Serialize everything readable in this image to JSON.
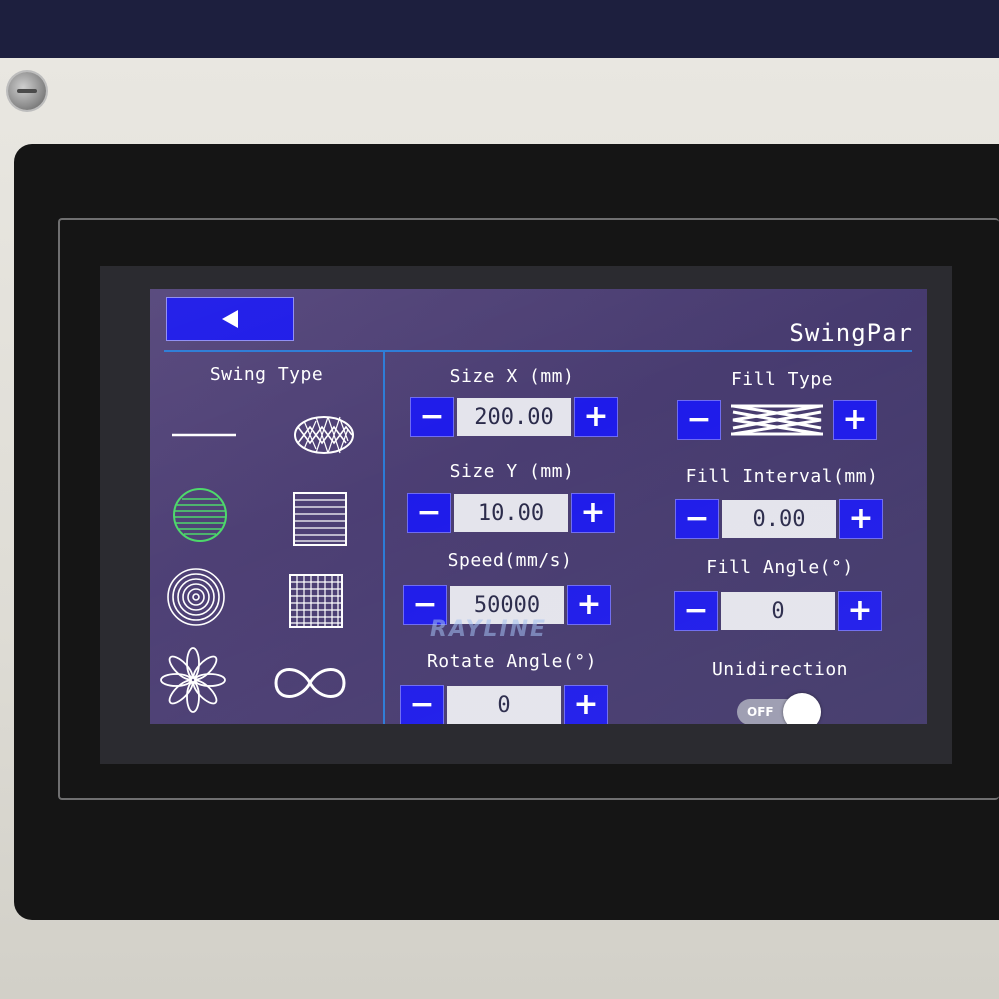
{
  "header": {
    "title": "SwingPar"
  },
  "swing_type": {
    "title": "Swing Type",
    "icons": [
      "line-pattern-icon",
      "crosshatch-oval-icon",
      "circle-lines-icon",
      "square-lines-icon",
      "concentric-circles-icon",
      "grid-square-icon",
      "flower-icon",
      "infinity-icon"
    ]
  },
  "fields": {
    "size_x": {
      "label": "Size X (mm)",
      "value": "200.00"
    },
    "size_y": {
      "label": "Size Y (mm)",
      "value": "10.00"
    },
    "speed": {
      "label": "Speed(mm/s)",
      "value": "50000"
    },
    "rotate_angle": {
      "label": "Rotate Angle(°)",
      "value": "0"
    },
    "fill_type": {
      "label": "Fill Type"
    },
    "fill_interval": {
      "label": "Fill Interval(mm)",
      "value": "0.00"
    },
    "fill_angle": {
      "label": "Fill Angle(°)",
      "value": "0"
    },
    "unidirection": {
      "label": "Unidirection",
      "state": "OFF"
    }
  },
  "buttons": {
    "minus": "−",
    "plus": "+"
  },
  "watermark": "RAYLINE",
  "colors": {
    "accent_blue": "#1e1bea",
    "screen_bg": "#4a3d72",
    "line_blue": "#2b7bd6",
    "green_icon": "#4cd96a"
  }
}
